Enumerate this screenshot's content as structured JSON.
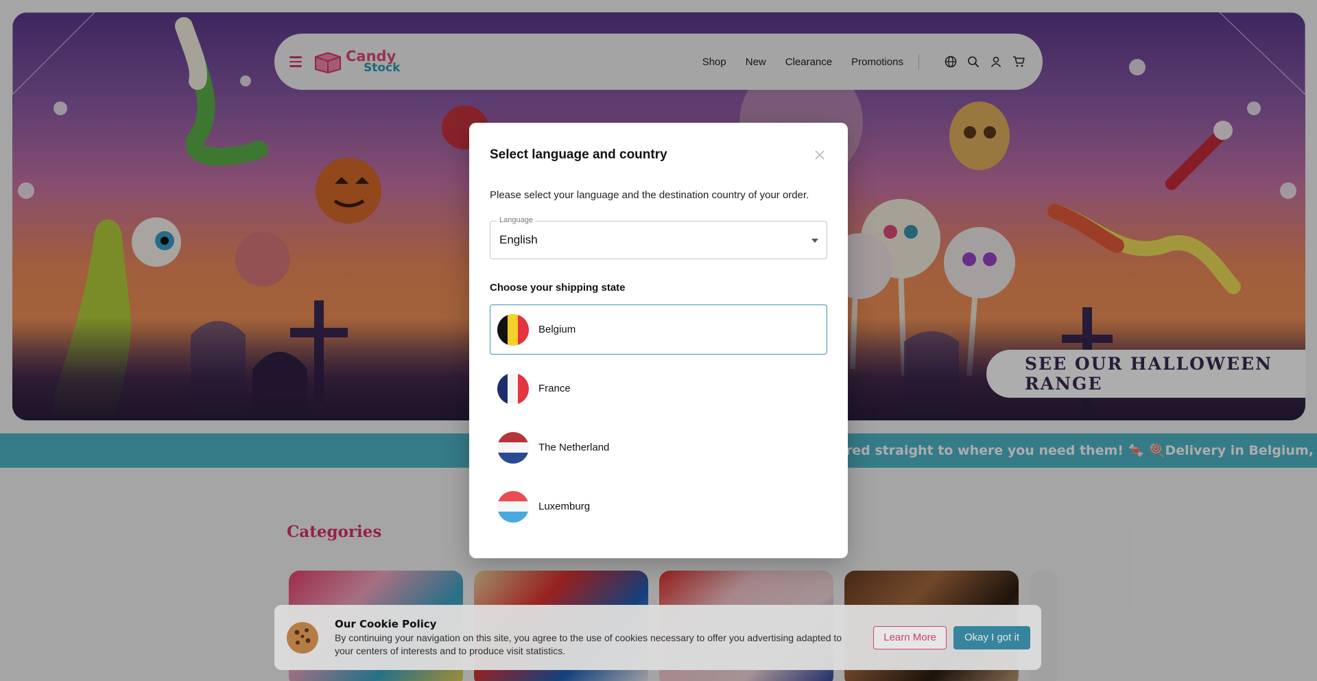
{
  "header": {
    "logo_line1": "Candy",
    "logo_line2": "Stock",
    "nav": [
      "Shop",
      "New",
      "Clearance",
      "Promotions"
    ],
    "icons": [
      "globe-icon",
      "search-icon",
      "user-icon",
      "cart-icon"
    ]
  },
  "hero": {
    "cta": "SEE OUR HALLOWEEN RANGE"
  },
  "strip": {
    "text": "ered straight to where you need them! 🍬 🍭Delivery in Belgium, France"
  },
  "categories": {
    "title": "Categories"
  },
  "modal": {
    "title": "Select language and country",
    "description": "Please select your language and the destination country of your order.",
    "language_label": "Language",
    "language_value": "English",
    "shipping_title": "Choose your shipping state",
    "countries": [
      {
        "name": "Belgium",
        "selected": true
      },
      {
        "name": "France",
        "selected": false
      },
      {
        "name": "The Netherland",
        "selected": false
      },
      {
        "name": "Luxemburg",
        "selected": false
      }
    ]
  },
  "cookie": {
    "title": "Our Cookie Policy",
    "body": "By continuing your navigation on this site, you agree to the use of cookies necessary to offer you advertising adapted to your centers of interests and to produce visit statistics.",
    "learn_more": "Learn More",
    "ok": "Okay I got it"
  },
  "colors": {
    "brand_pink": "#e04a79",
    "brand_teal": "#4fb6c9",
    "button_blue": "#3c93b0"
  }
}
